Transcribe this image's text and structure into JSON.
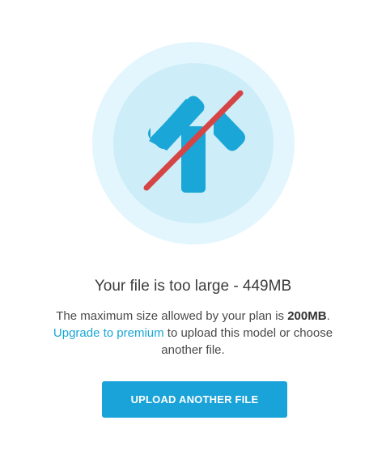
{
  "colors": {
    "outer_circle": "#e3f6fd",
    "inner_circle": "#cdeef9",
    "arrow": "#1aa6d6",
    "strike": "#d64545",
    "link": "#1aa6d6",
    "button_bg": "#1aa3d9",
    "button_text": "#ffffff"
  },
  "illustration": {
    "icon": "upload-arrow-crossed-icon"
  },
  "title": "Your file is too large - 449MB",
  "message": {
    "line1_prefix": "The maximum size allowed by your plan is ",
    "line1_limit": "200MB",
    "line1_suffix": ".",
    "upgrade_link": "Upgrade to premium",
    "line2_rest": " to upload this model or choose another file."
  },
  "button": {
    "label": "UPLOAD ANOTHER FILE"
  }
}
